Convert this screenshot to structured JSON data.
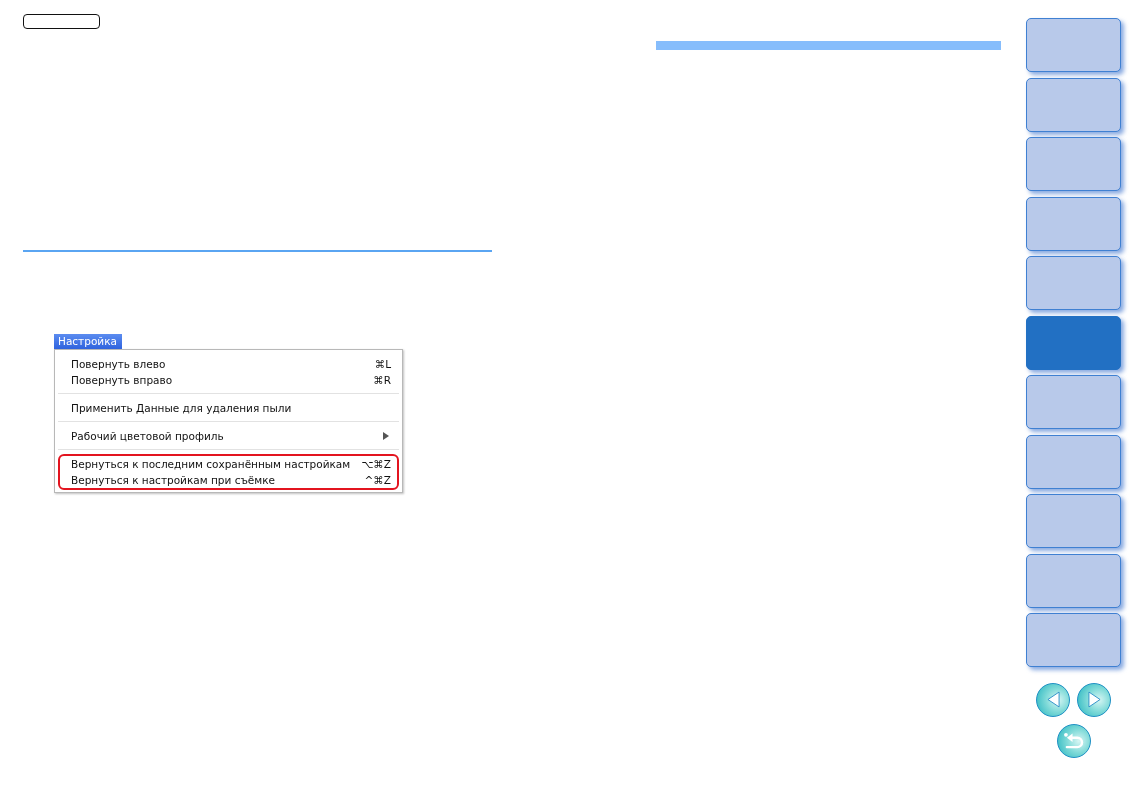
{
  "menu": {
    "title": "Настройка",
    "groups": [
      {
        "highlighted": false,
        "items": [
          {
            "label": "Повернуть влево",
            "shortcut": "⌘L",
            "submenu": false
          },
          {
            "label": "Повернуть вправо",
            "shortcut": "⌘R",
            "submenu": false
          }
        ]
      },
      {
        "highlighted": false,
        "items": [
          {
            "label": "Применить Данные для удаления пыли",
            "submenu": false
          }
        ]
      },
      {
        "highlighted": false,
        "items": [
          {
            "label": "Рабочий цветовой профиль",
            "submenu": true
          }
        ]
      },
      {
        "highlighted": true,
        "items": [
          {
            "label": "Вернуться к последним сохранённым настройкам",
            "shortcut": "⌥⌘Z",
            "submenu": false
          },
          {
            "label": "Вернуться к настройкам при съёмке",
            "shortcut": "^⌘Z",
            "submenu": false
          }
        ]
      }
    ]
  },
  "sidebar": {
    "tabs": [
      {
        "selected": false
      },
      {
        "selected": false
      },
      {
        "selected": false
      },
      {
        "selected": false
      },
      {
        "selected": false
      },
      {
        "selected": true
      },
      {
        "selected": false
      },
      {
        "selected": false
      },
      {
        "selected": false
      },
      {
        "selected": false
      },
      {
        "selected": false
      }
    ]
  }
}
